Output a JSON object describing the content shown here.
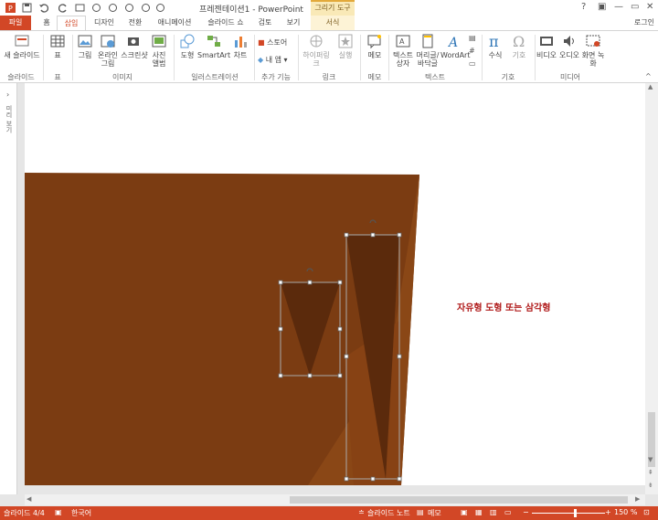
{
  "window": {
    "title": "프레젠테이션1 - PowerPoint",
    "context_tab_group": "그리기 도구",
    "login": "로그인"
  },
  "tabs": [
    {
      "label": "파일"
    },
    {
      "label": "홈"
    },
    {
      "label": "삽입"
    },
    {
      "label": "디자인"
    },
    {
      "label": "전환"
    },
    {
      "label": "애니메이션"
    },
    {
      "label": "슬라이드 쇼"
    },
    {
      "label": "검토"
    },
    {
      "label": "보기"
    },
    {
      "label": "서식"
    }
  ],
  "ribbon": {
    "buttons": {
      "new_slide": "새 슬라이드",
      "table": "표",
      "picture": "그림",
      "online_picture": "온라인 그림",
      "screenshot": "스크린샷",
      "photo_album": "사진 앨범",
      "shapes": "도형",
      "smartart": "SmartArt",
      "chart": "차트",
      "store": "스토어",
      "my_apps": "내 앱",
      "hyperlink": "하이퍼링크",
      "action": "실행",
      "comment": "메모",
      "textbox": "텍스트 상자",
      "header_footer": "머리글/바닥글",
      "wordart": "WordArt",
      "equation": "수식",
      "symbol": "기호",
      "video": "비디오",
      "audio": "오디오",
      "screen_recording": "화면 녹화"
    },
    "groups": {
      "slides": "슬라이드",
      "tables": "표",
      "images": "이미지",
      "illustrations": "일러스트레이션",
      "addins": "추가 기능",
      "links": "링크",
      "comments": "메모",
      "text": "텍스트",
      "symbols": "기호",
      "media": "미디어"
    }
  },
  "left_panel_label": "미리 보기",
  "slide": {
    "caption": "자유형 도형 또는 삼각형",
    "colors": {
      "background_shape": "#7b3c12",
      "selected_fill": "#5b2a0c",
      "caption": "#b01a1a"
    }
  },
  "statusbar": {
    "slide_index": "슬라이드 4/4",
    "language": "한국어",
    "notes": "슬라이드 노트",
    "comments": "메모",
    "zoom": "150 %"
  },
  "colors": {
    "accent": "#d24726"
  }
}
